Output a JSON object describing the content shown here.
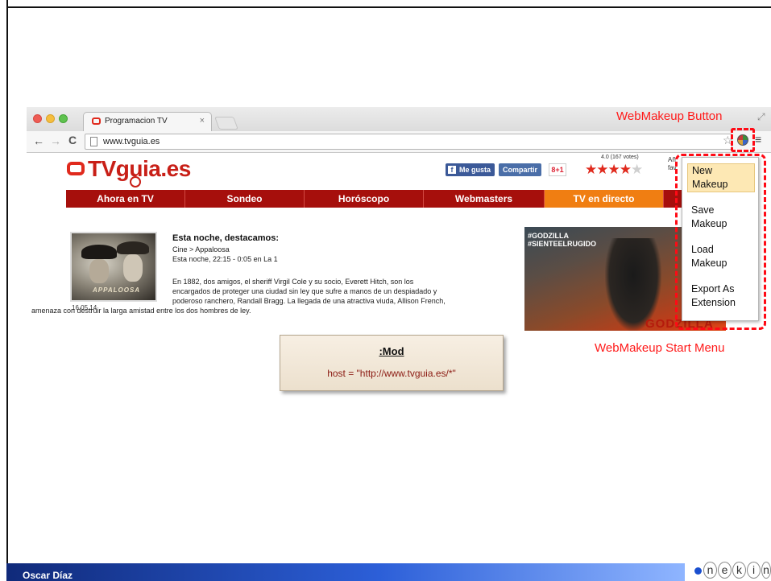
{
  "browser": {
    "tab_title": "Programacion TV",
    "tab_close": "×",
    "url": "www.tvguia.es",
    "back_glyph": "←",
    "forward_glyph": "→",
    "reload_glyph": "C",
    "star_glyph": "☆",
    "menu_glyph": "≡",
    "resize_glyph": "⤢"
  },
  "site": {
    "logo_text": "TVguia.es",
    "facebook_like": "Me gusta",
    "facebook_glyph": "f",
    "share": "Compartir",
    "gplus": "8+1",
    "rating_votes": "4.0 (167 votes)",
    "rating_filled": "★★★★",
    "rating_empty": "★",
    "rating_value": 4.0,
    "cut_label_1": "Añ",
    "cut_label_2": "fav",
    "nav": [
      {
        "label": "Ahora en TV"
      },
      {
        "label": "Sondeo"
      },
      {
        "label": "Horóscopo"
      },
      {
        "label": "Webmasters"
      },
      {
        "label": "TV en directo"
      }
    ],
    "article": {
      "heading": "Esta noche, destacamos:",
      "category": "Cine > Appaloosa",
      "time": "Esta noche, 22:15 - 0:05 en La 1",
      "body": [
        "En 1882, dos amigos, el sheriff Virgil Cole y su socio, Everett Hitch, son los",
        "encargados de proteger una ciudad sin ley que sufre a manos de un despiadado y",
        "poderoso ranchero, Randall Bragg. La llegada de una atractiva viuda, Allison French,",
        "amenaza con destruir la larga amistad entre los dos hombres de ley."
      ],
      "date": "16.05.14",
      "image_caption": "APPALOOSA"
    },
    "promo": {
      "line1": "#GODZILLA",
      "line2": "#SIENTEELRUGIDO",
      "logo": "GODZILLA"
    }
  },
  "webmakeup": {
    "button_label": "WebMakeup Button",
    "menu_label": "WebMakeup Start Menu",
    "menu_items": [
      {
        "line1": "New",
        "line2": "Makeup"
      },
      {
        "line1": "Save",
        "line2": "Makeup"
      },
      {
        "line1": "Load",
        "line2": "Makeup"
      },
      {
        "line1": "Export As",
        "line2": "Extension"
      }
    ],
    "highlight_color": "#ff0a15"
  },
  "mod": {
    "title": ":Mod",
    "host": "host = \"http://www.tvguia.es/*\""
  },
  "footer": {
    "author": "Oscar Díaz",
    "logo_letters": [
      "n",
      "e",
      "k",
      "i",
      "n"
    ]
  }
}
